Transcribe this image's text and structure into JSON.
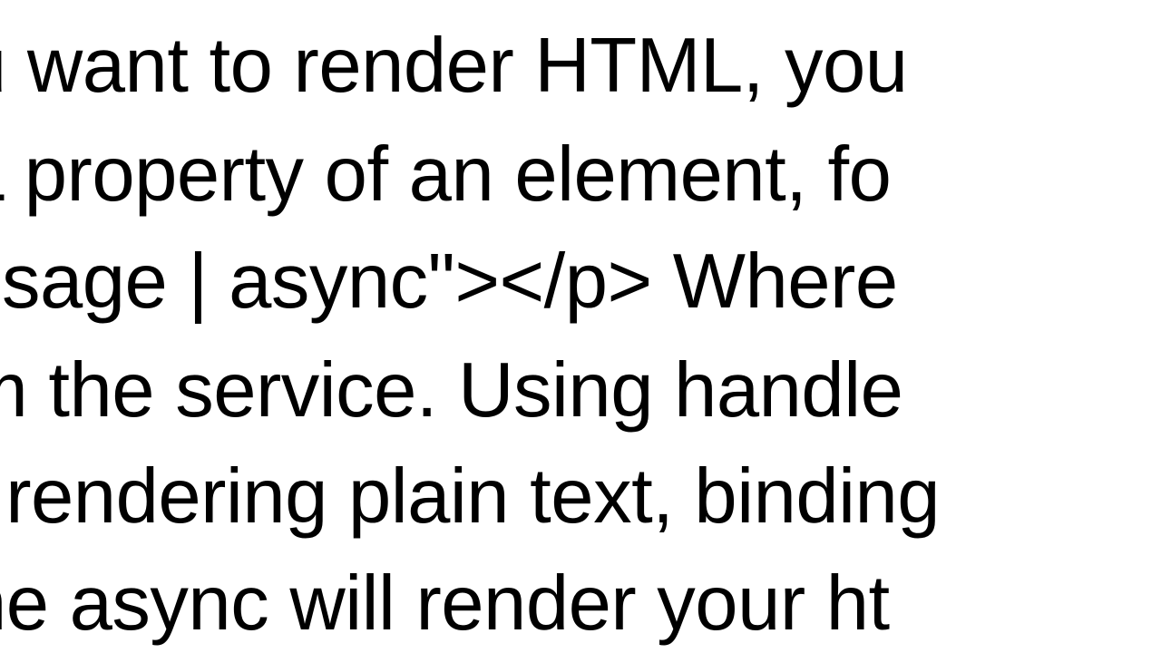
{
  "body": {
    "lines": [
      "u want to render HTML, you",
      "L property of an element, fo",
      "ssage | async\"></p>  Where",
      "m the service. Using handle",
      ": rendering plain text, binding",
      "he async will render your ht"
    ]
  }
}
